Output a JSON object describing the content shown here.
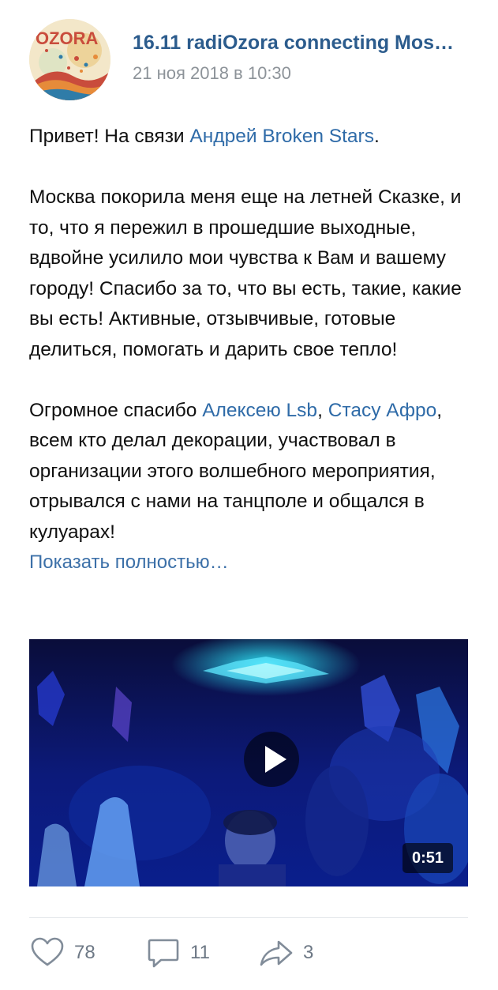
{
  "post": {
    "title": "16.11 radiOzora connecting Mos…",
    "date": "21 ноя 2018 в 10:30",
    "avatar_text": "OZORA"
  },
  "body": {
    "p1_text": "Привет! На связи ",
    "p1_link": "Андрей Broken Stars",
    "p1_end": ".",
    "p2": "Москва покорила меня еще на летней Сказке, и то, что я пережил в прошедшие выходные, вдвойне усилило мои чувства к Вам и вашему городу! Спасибо за то, что вы есть, такие, какие вы есть! Активные, отзывчивые, готовые делиться, помогать и дарить свое тепло!",
    "p3_text": "Огромное спасибо ",
    "p3_link1": "Алексею Lsb",
    "p3_sep": ", ",
    "p3_link2": "Стасу Афро",
    "p3_end": ", всем кто делал декорации, участвовал в организации этого волшебного мероприятия, отрывался с нами на танцполе и общался в кулуарах!",
    "show_more": "Показать полностью…"
  },
  "video": {
    "duration": "0:51",
    "play_icon": "play-icon"
  },
  "actions": {
    "likes": "78",
    "comments": "11",
    "shares": "3",
    "like_icon": "heart-icon",
    "comment_icon": "comment-bubble-icon",
    "share_icon": "share-arrow-icon"
  },
  "colors": {
    "link": "#2f6ba8",
    "title": "#2c5c8d",
    "meta": "#8d9399",
    "icon": "#818c99"
  }
}
